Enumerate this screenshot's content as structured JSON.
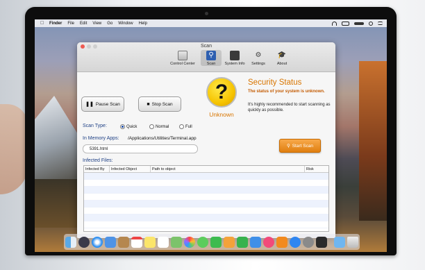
{
  "menubar": {
    "app_name": "Finder",
    "items": [
      "File",
      "Edit",
      "View",
      "Go",
      "Window",
      "Help"
    ]
  },
  "window": {
    "title": "Scan"
  },
  "toolbar": {
    "items": [
      {
        "label": "Control Center",
        "icon": "control-center-icon"
      },
      {
        "label": "Scan",
        "icon": "scan-icon"
      },
      {
        "label": "System Info",
        "icon": "system-info-icon"
      },
      {
        "label": "Settings",
        "icon": "settings-icon"
      },
      {
        "label": "About",
        "icon": "about-icon"
      }
    ]
  },
  "buttons": {
    "pause": "Pause Scan",
    "stop": "Stop Scan",
    "start": "Start Scan"
  },
  "status": {
    "icon_glyph": "?",
    "label": "Unknown",
    "title": "Security Status",
    "status_text": "The status of your system is unknown.",
    "description": "It's highly recommended to start scanning as quickly as possible."
  },
  "scan_type": {
    "label": "Scan Type:",
    "options": [
      "Quick",
      "Normal",
      "Full"
    ],
    "selected": "Quick"
  },
  "memory": {
    "label": "In Memory Apps:",
    "path": "/Applications/Utilities/Terminal.app",
    "field_value": "5391.html"
  },
  "infected": {
    "label": "Infected Files:",
    "columns": [
      "Infected By",
      "Infected Object",
      "Path to object",
      "Risk"
    ],
    "rows": []
  },
  "colors": {
    "accent_orange": "#e07f10",
    "label_blue": "#1d3f84",
    "status_yellow": "#f6c400"
  }
}
